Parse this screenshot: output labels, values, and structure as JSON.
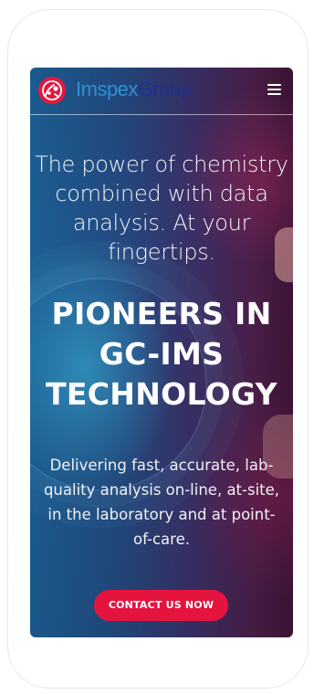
{
  "brand": {
    "name_part1": "Imspex",
    "name_part2": "Group",
    "logo_icon": "imspex-logo-icon",
    "logo_color": "#e5173f"
  },
  "header": {
    "menu_icon": "hamburger-menu-icon"
  },
  "hero": {
    "tagline": "The power of chemistry combined with data analysis. At your fingertips.",
    "headline_lines": [
      "PIONEERS IN",
      "GC-IMS",
      "TECHNOLOGY"
    ],
    "description": "Delivering fast, accurate, lab-quality analysis on-line, at-site, in the laboratory and at point-of-care.",
    "cta_label": "CONTACT US NOW"
  },
  "colors": {
    "accent": "#e4143f",
    "brand_blue": "#2f8fd6",
    "brand_navy": "#1f2f8f"
  }
}
